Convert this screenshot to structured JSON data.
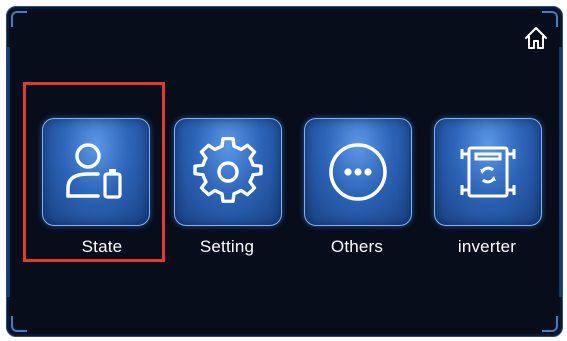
{
  "screen": {
    "accent": "#3d7fc9",
    "background": "#070d1a"
  },
  "header": {
    "home_icon": "home-icon"
  },
  "menu": {
    "items": [
      {
        "label": "State",
        "icon": "user-battery-icon",
        "selected": true
      },
      {
        "label": "Setting",
        "icon": "gear-icon",
        "selected": false
      },
      {
        "label": "Others",
        "icon": "more-dots-icon",
        "selected": false
      },
      {
        "label": "inverter",
        "icon": "inverter-icon",
        "selected": false
      }
    ]
  },
  "highlight": {
    "color": "#e5392f",
    "target": "State"
  }
}
